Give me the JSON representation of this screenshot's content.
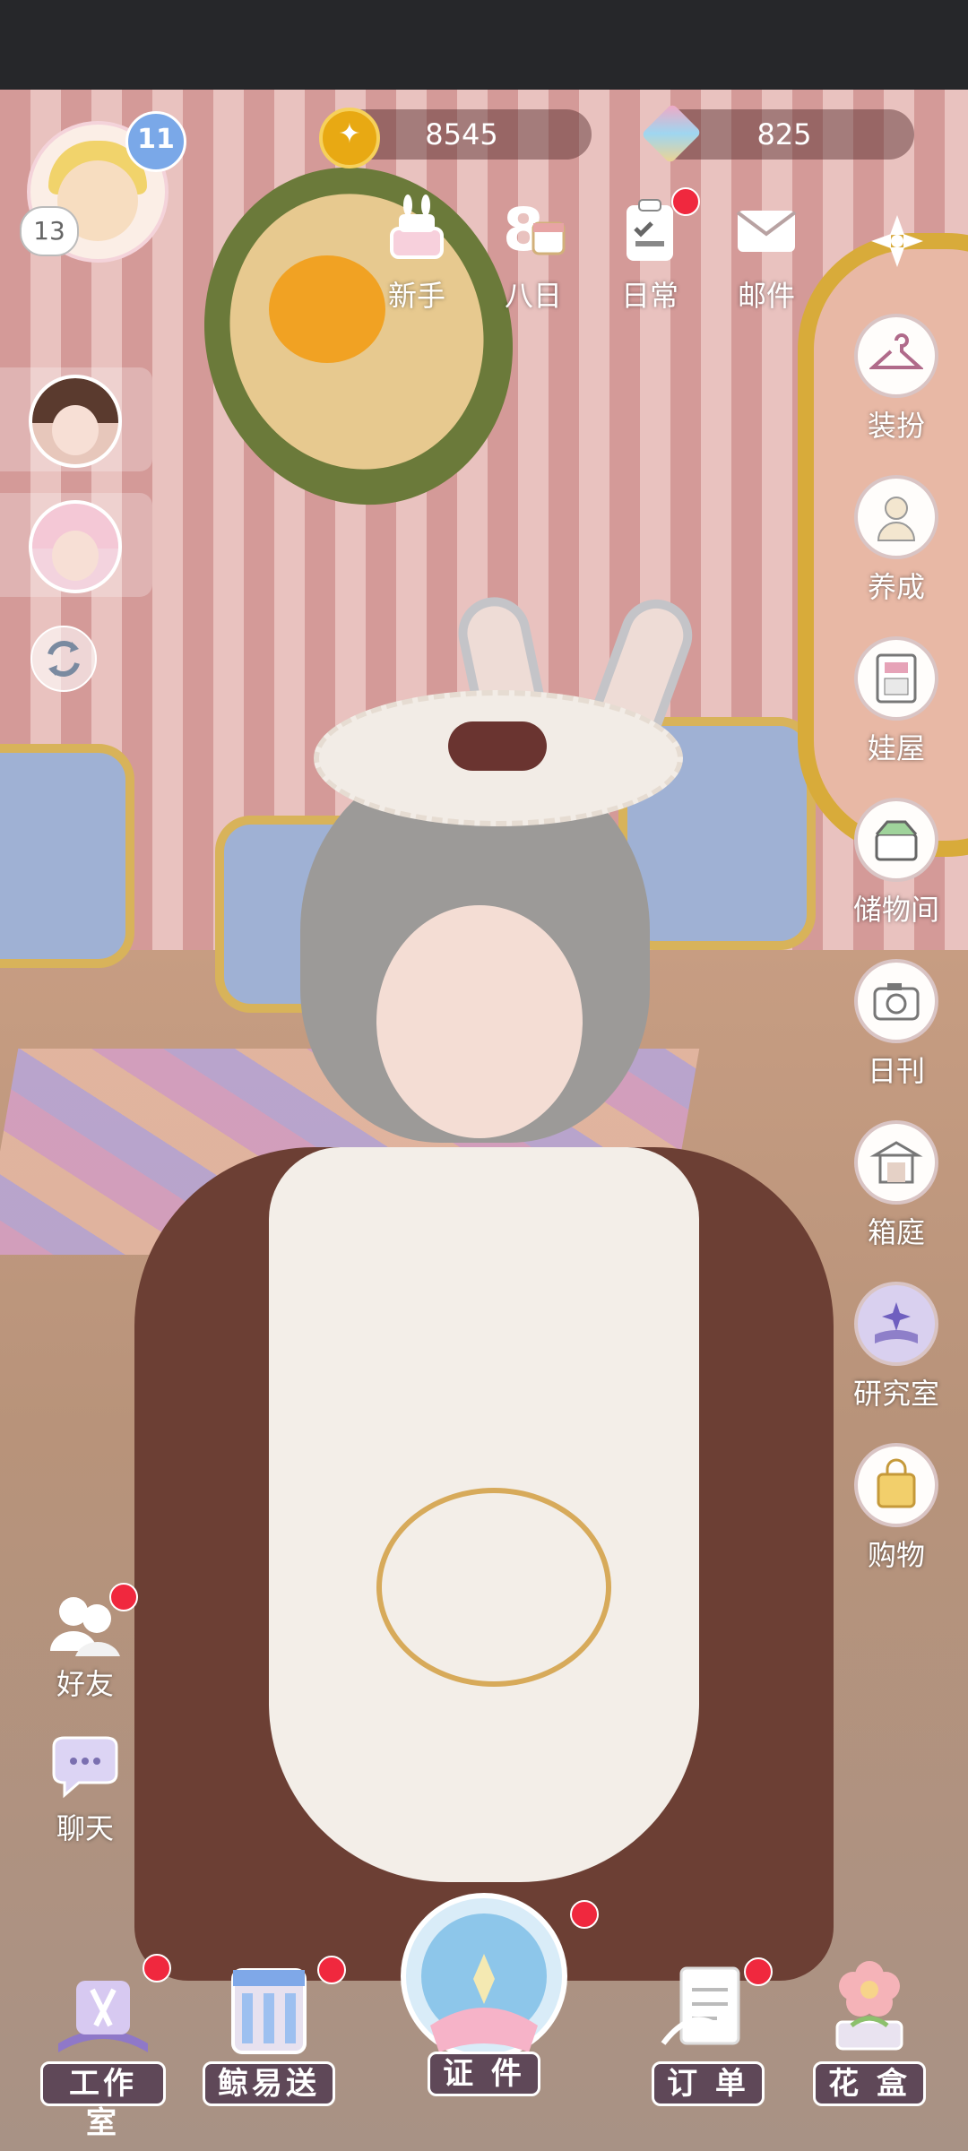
{
  "currency": {
    "coins": "8545",
    "gems": "825"
  },
  "player": {
    "level_star": "11",
    "level": "13"
  },
  "top_menu": [
    {
      "label": "新手",
      "icon": "cake-icon"
    },
    {
      "label": "八日",
      "icon": "eight-day-icon"
    },
    {
      "label": "日常",
      "icon": "clipboard-icon"
    },
    {
      "label": "邮件",
      "icon": "mail-icon"
    }
  ],
  "right_menu": [
    {
      "label": "装扮",
      "icon": "hanger-icon"
    },
    {
      "label": "养成",
      "icon": "character-icon"
    },
    {
      "label": "娃屋",
      "icon": "cabinet-icon"
    },
    {
      "label": "储物间",
      "icon": "storage-box-icon"
    },
    {
      "label": "日刊",
      "icon": "camera-icon"
    },
    {
      "label": "箱庭",
      "icon": "pavilion-icon"
    },
    {
      "label": "研究室",
      "icon": "research-book-icon"
    },
    {
      "label": "购物",
      "icon": "shopping-bag-icon"
    }
  ],
  "left_social": [
    {
      "label": "好友",
      "icon": "friends-icon"
    },
    {
      "label": "聊天",
      "icon": "chat-icon"
    }
  ],
  "bottom_nav": [
    {
      "label": "工作室",
      "icon": "studio-icon"
    },
    {
      "label": "鲸易送",
      "icon": "delivery-icon"
    },
    {
      "label": "证 件",
      "icon": "certificate-icon"
    },
    {
      "label": "订 单",
      "icon": "order-icon"
    },
    {
      "label": "花 盒",
      "icon": "flower-box-icon"
    }
  ],
  "colors": {
    "notification": "#f0283e",
    "label_bg": "#5f4858",
    "coin": "#e8a913"
  }
}
